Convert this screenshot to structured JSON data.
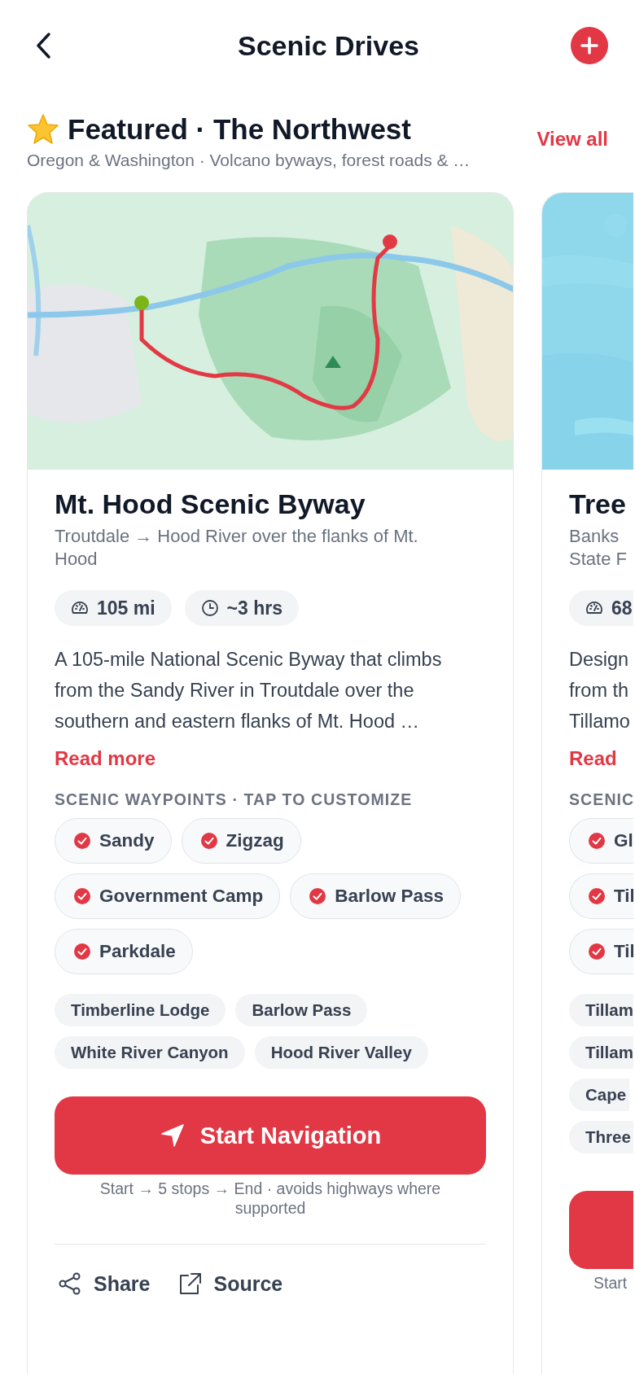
{
  "header": {
    "title": "Scenic Drives"
  },
  "section": {
    "title": "Featured · The Northwest",
    "subtitle": "Oregon & Washington · Volcano byways, forest roads & …",
    "view_all": "View all"
  },
  "cards": [
    {
      "picture": {
        "kind": "picture"
      },
      "title": "Mt. Hood Scenic Byway",
      "subtitle_lines": [
        "Troutdale → Hood River over the flanks of Mt.",
        "Hood"
      ],
      "distance": "105 mi",
      "duration": "~3 hrs",
      "description_lines": [
        "A 105-mile National Scenic Byway that climbs",
        "from the Sandy River in Troutdale over the",
        "southern and eastern flanks of Mt. Hood …"
      ],
      "read_more": "Read more",
      "waypoints_label": "SCENIC WAYPOINTS · TAP TO CUSTOMIZE",
      "waypoints": [
        {
          "label": "Sandy",
          "checked": true
        },
        {
          "label": "Zigzag",
          "checked": true
        },
        {
          "label": "Government Camp",
          "checked": true
        },
        {
          "label": "Barlow Pass",
          "checked": true
        },
        {
          "label": "Parkdale",
          "checked": true
        }
      ],
      "tags": [
        "Timberline Lodge",
        "Barlow Pass",
        "White River Canyon",
        "Hood River Valley"
      ],
      "button_label": "Start Navigation",
      "note": "Start → 5 stops → End · avoids highways where supported",
      "actions": [
        {
          "kind": "share",
          "label": "Share"
        },
        {
          "kind": "source",
          "label": "Source"
        }
      ]
    },
    {
      "picture": {
        "kind": "picture"
      },
      "title": "Tree",
      "subtitle_lines": [
        "Banks",
        "State F"
      ],
      "distance": "68",
      "description_lines": [
        "Design",
        "from th",
        "Tillamo"
      ],
      "read_more": "Read",
      "waypoints_label": "SCENIC",
      "waypoints": [
        {
          "label": "Gl",
          "checked": true
        },
        {
          "label": "Til",
          "checked": true
        },
        {
          "label": "Til",
          "checked": true
        }
      ],
      "tags": [
        "Tillam",
        "Tillam",
        "Cape",
        "Three"
      ],
      "note": "Start"
    }
  ]
}
